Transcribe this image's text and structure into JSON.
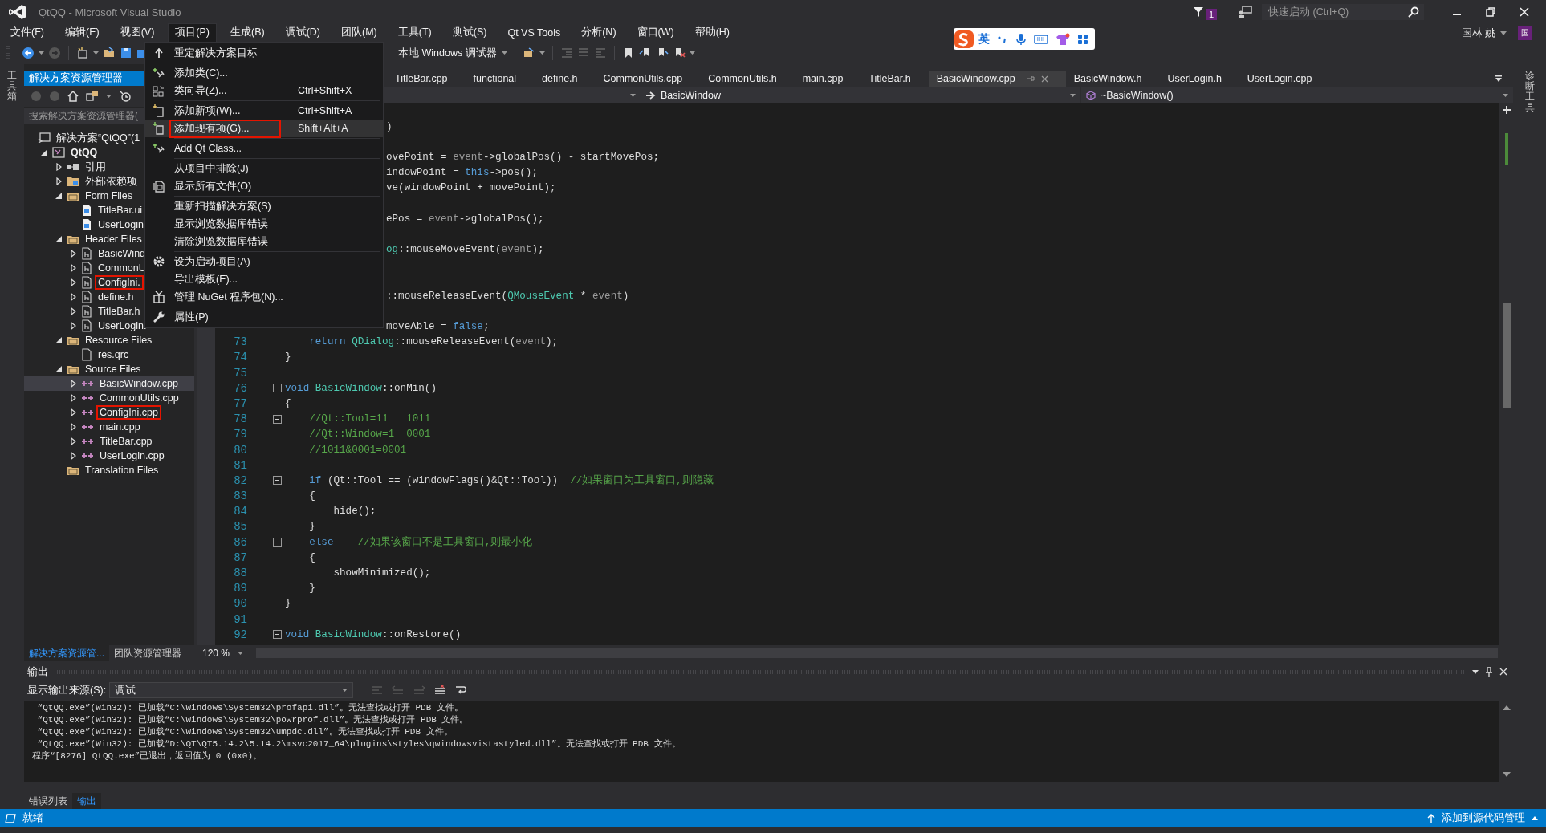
{
  "window": {
    "title": "QtQQ - Microsoft Visual Studio",
    "notification_count": "1",
    "quick_launch": {
      "placeholder": "快速启动 (Ctrl+Q)"
    }
  },
  "menu_bar": [
    {
      "label": "文件(F)",
      "selected": false
    },
    {
      "label": "编辑(E)",
      "selected": false
    },
    {
      "label": "视图(V)",
      "selected": false
    },
    {
      "label": "项目(P)",
      "selected": true
    },
    {
      "label": "生成(B)",
      "selected": false
    },
    {
      "label": "调试(D)",
      "selected": false
    },
    {
      "label": "团队(M)",
      "selected": false
    },
    {
      "label": "工具(T)",
      "selected": false
    },
    {
      "label": "测试(S)",
      "selected": false
    },
    {
      "label": "Qt VS Tools",
      "selected": false
    },
    {
      "label": "分析(N)",
      "selected": false
    },
    {
      "label": "窗口(W)",
      "selected": false
    },
    {
      "label": "帮助(H)",
      "selected": false
    }
  ],
  "account": {
    "name": "国林 姚",
    "avatar": "国"
  },
  "toolbar": {
    "debugger": "本地 Windows 调试器"
  },
  "ime_bar": {
    "mode": "英"
  },
  "side_strips": {
    "left": "工具箱",
    "right": "诊断工具"
  },
  "project_menu": [
    {
      "kind": "item",
      "label": "重定解决方案目标",
      "selected": false,
      "highlighted": false
    },
    {
      "kind": "separator"
    },
    {
      "kind": "item",
      "label": "添加类(C)...",
      "selected": false,
      "highlighted": false
    },
    {
      "kind": "item",
      "label": "类向导(Z)...",
      "shortcut": "Ctrl+Shift+X",
      "selected": false,
      "highlighted": false
    },
    {
      "kind": "separator"
    },
    {
      "kind": "item",
      "label": "添加新项(W)...",
      "shortcut": "Ctrl+Shift+A",
      "selected": false,
      "highlighted": false
    },
    {
      "kind": "item",
      "label": "添加现有项(G)...",
      "shortcut": "Shift+Alt+A",
      "selected": true,
      "highlighted": true
    },
    {
      "kind": "separator"
    },
    {
      "kind": "item",
      "label": "Add Qt Class...",
      "selected": false,
      "highlighted": false
    },
    {
      "kind": "separator"
    },
    {
      "kind": "item",
      "label": "从项目中排除(J)",
      "selected": false,
      "highlighted": false
    },
    {
      "kind": "item",
      "label": "显示所有文件(O)",
      "selected": false,
      "highlighted": false
    },
    {
      "kind": "separator"
    },
    {
      "kind": "item",
      "label": "重新扫描解决方案(S)",
      "selected": false,
      "highlighted": false
    },
    {
      "kind": "item",
      "label": "显示浏览数据库错误",
      "selected": false,
      "highlighted": false
    },
    {
      "kind": "item",
      "label": "清除浏览数据库错误",
      "selected": false,
      "highlighted": false
    },
    {
      "kind": "separator"
    },
    {
      "kind": "item",
      "label": "设为启动项目(A)",
      "selected": false,
      "highlighted": false
    },
    {
      "kind": "item",
      "label": "导出模板(E)...",
      "selected": false,
      "highlighted": false
    },
    {
      "kind": "item",
      "label": "管理 NuGet 程序包(N)...",
      "selected": false,
      "highlighted": false
    },
    {
      "kind": "separator"
    },
    {
      "kind": "item",
      "label": "属性(P)",
      "selected": false,
      "highlighted": false
    }
  ],
  "solution_explorer": {
    "title": "解决方案资源管理器",
    "search": {
      "placeholder": "搜索解决方案资源管理器("
    },
    "tree": [
      {
        "label": "解决方案“QtQQ”(1",
        "kind": "solution",
        "selected": false,
        "highlighted": false,
        "children": [
          {
            "label": "QtQQ",
            "kind": "project",
            "expanded": true,
            "selected": false,
            "highlighted": false,
            "children": [
              {
                "label": "引用",
                "kind": "references",
                "expanded": false,
                "selected": false,
                "highlighted": false
              },
              {
                "label": "外部依赖项",
                "kind": "dependencies",
                "expanded": false,
                "selected": false,
                "highlighted": false
              },
              {
                "label": "Form Files",
                "kind": "folder",
                "expanded": true,
                "selected": false,
                "highlighted": false,
                "children": [
                  {
                    "label": "TitleBar.ui",
                    "kind": "ui",
                    "selected": false,
                    "highlighted": false
                  },
                  {
                    "label": "UserLogin",
                    "kind": "ui",
                    "selected": false,
                    "highlighted": false
                  }
                ]
              },
              {
                "label": "Header Files",
                "kind": "folder",
                "expanded": true,
                "selected": false,
                "highlighted": false,
                "children": [
                  {
                    "label": "BasicWind",
                    "kind": "header",
                    "expanded": false,
                    "selected": false,
                    "highlighted": false
                  },
                  {
                    "label": "CommonU",
                    "kind": "header",
                    "expanded": false,
                    "selected": false,
                    "highlighted": false
                  },
                  {
                    "label": "ConfigIni.",
                    "kind": "header",
                    "expanded": false,
                    "selected": false,
                    "highlighted": true
                  },
                  {
                    "label": "define.h",
                    "kind": "header",
                    "expanded": false,
                    "selected": false,
                    "highlighted": false
                  },
                  {
                    "label": "TitleBar.h",
                    "kind": "header",
                    "expanded": false,
                    "selected": false,
                    "highlighted": false
                  },
                  {
                    "label": "UserLogin.",
                    "kind": "header",
                    "expanded": false,
                    "selected": false,
                    "highlighted": false
                  }
                ]
              },
              {
                "label": "Resource Files",
                "kind": "folder",
                "expanded": true,
                "selected": false,
                "highlighted": false,
                "children": [
                  {
                    "label": "res.qrc",
                    "kind": "resource",
                    "selected": false,
                    "highlighted": false
                  }
                ]
              },
              {
                "label": "Source Files",
                "kind": "folder",
                "expanded": true,
                "selected": false,
                "highlighted": false,
                "children": [
                  {
                    "label": "BasicWindow.cpp",
                    "kind": "source",
                    "expanded": false,
                    "selected": true,
                    "highlighted": false
                  },
                  {
                    "label": "CommonUtils.cpp",
                    "kind": "source",
                    "expanded": false,
                    "selected": false,
                    "highlighted": false
                  },
                  {
                    "label": "ConfigIni.cpp",
                    "kind": "source",
                    "expanded": false,
                    "selected": false,
                    "highlighted": true
                  },
                  {
                    "label": "main.cpp",
                    "kind": "source",
                    "expanded": false,
                    "selected": false,
                    "highlighted": false
                  },
                  {
                    "label": "TitleBar.cpp",
                    "kind": "source",
                    "expanded": false,
                    "selected": false,
                    "highlighted": false
                  },
                  {
                    "label": "UserLogin.cpp",
                    "kind": "source",
                    "expanded": false,
                    "selected": false,
                    "highlighted": false
                  }
                ]
              },
              {
                "label": "Translation Files",
                "kind": "folder",
                "selected": false,
                "highlighted": false
              }
            ]
          }
        ]
      }
    ],
    "tabs": [
      {
        "label": "解决方案资源管...",
        "selected": true
      },
      {
        "label": "团队资源管理器",
        "selected": false
      }
    ]
  },
  "editor": {
    "tabs": [
      {
        "label": "TitleBar.cpp",
        "selected": false
      },
      {
        "label": "functional",
        "selected": false
      },
      {
        "label": "define.h",
        "selected": false
      },
      {
        "label": "CommonUtils.cpp",
        "selected": false
      },
      {
        "label": "CommonUtils.h",
        "selected": false
      },
      {
        "label": "main.cpp",
        "selected": false
      },
      {
        "label": "TitleBar.h",
        "selected": false
      },
      {
        "label": "BasicWindow.cpp",
        "selected": true
      },
      {
        "label": "BasicWindow.h",
        "selected": false
      },
      {
        "label": "UserLogin.h",
        "selected": false
      },
      {
        "label": "UserLogin.cpp",
        "selected": false
      }
    ],
    "nav": {
      "scope": "BasicWindow",
      "member": "~BasicWindow()"
    },
    "zoom": "120 %",
    "lines": [
      {
        "kind": "covered",
        "tokens": [
          {
            "kind": "plain",
            "text": ")"
          }
        ]
      },
      {
        "kind": "covered"
      },
      {
        "kind": "covered",
        "tokens": [
          {
            "kind": "plain",
            "text": "ovePoint = "
          },
          {
            "kind": "param",
            "text": "event"
          },
          {
            "kind": "plain",
            "text": "->globalPos() - startMovePos;"
          }
        ]
      },
      {
        "kind": "covered",
        "tokens": [
          {
            "kind": "plain",
            "text": "indowPoint = "
          },
          {
            "kind": "keyword",
            "text": "this"
          },
          {
            "kind": "plain",
            "text": "->pos();"
          }
        ]
      },
      {
        "kind": "covered",
        "tokens": [
          {
            "kind": "plain",
            "text": "ve(windowPoint + movePoint);"
          }
        ]
      },
      {
        "kind": "covered"
      },
      {
        "kind": "covered",
        "tokens": [
          {
            "kind": "plain",
            "text": "ePos = "
          },
          {
            "kind": "param",
            "text": "event"
          },
          {
            "kind": "plain",
            "text": "->globalPos();"
          }
        ]
      },
      {
        "kind": "covered"
      },
      {
        "kind": "covered",
        "tokens": [
          {
            "kind": "type",
            "text": "og"
          },
          {
            "kind": "plain",
            "text": "::mouseMoveEvent("
          },
          {
            "kind": "param",
            "text": "event"
          },
          {
            "kind": "plain",
            "text": ");"
          }
        ]
      },
      {
        "kind": "covered"
      },
      {
        "kind": "covered"
      },
      {
        "kind": "covered",
        "tokens": [
          {
            "kind": "plain",
            "text": "::mouseReleaseEvent("
          },
          {
            "kind": "type",
            "text": "QMouseEvent"
          },
          {
            "kind": "plain",
            "text": " * "
          },
          {
            "kind": "param",
            "text": "event"
          },
          {
            "kind": "plain",
            "text": ")"
          }
        ]
      },
      {
        "kind": "covered"
      },
      {
        "kind": "covered",
        "tokens": [
          {
            "kind": "plain",
            "text": "moveAble = "
          },
          {
            "kind": "keyword",
            "text": "false"
          },
          {
            "kind": "plain",
            "text": ";"
          }
        ]
      },
      {
        "kind": "numbered",
        "number": "73",
        "tokens": [
          {
            "kind": "keyword",
            "text": "    return"
          },
          {
            "kind": "type",
            "text": " QDialog"
          },
          {
            "kind": "plain",
            "text": "::mouseReleaseEvent("
          },
          {
            "kind": "param",
            "text": "event"
          },
          {
            "kind": "plain",
            "text": ");"
          }
        ]
      },
      {
        "kind": "numbered",
        "number": "74",
        "tokens": [
          {
            "kind": "plain",
            "text": "}"
          }
        ]
      },
      {
        "kind": "numbered",
        "number": "75"
      },
      {
        "kind": "numbered",
        "number": "76",
        "fold": true,
        "tokens": [
          {
            "kind": "keyword",
            "text": "void"
          },
          {
            "kind": "type",
            "text": " BasicWindow"
          },
          {
            "kind": "plain",
            "text": "::onMin()"
          }
        ]
      },
      {
        "kind": "numbered",
        "number": "77",
        "tokens": [
          {
            "kind": "plain",
            "text": "{"
          }
        ]
      },
      {
        "kind": "numbered",
        "number": "78",
        "fold": true,
        "tokens": [
          {
            "kind": "comment",
            "text": "    //Qt::Tool=11   1011"
          }
        ]
      },
      {
        "kind": "numbered",
        "number": "79",
        "tokens": [
          {
            "kind": "comment",
            "text": "    //Qt::Window=1  0001"
          }
        ]
      },
      {
        "kind": "numbered",
        "number": "80",
        "tokens": [
          {
            "kind": "comment",
            "text": "    //1011&0001=0001"
          }
        ]
      },
      {
        "kind": "numbered",
        "number": "81"
      },
      {
        "kind": "numbered",
        "number": "82",
        "fold": true,
        "tokens": [
          {
            "kind": "keyword",
            "text": "    if"
          },
          {
            "kind": "plain",
            "text": " (Qt::Tool == (windowFlags()&Qt::Tool))  "
          },
          {
            "kind": "comment",
            "text": "//如果窗口为工具窗口,则隐藏"
          }
        ]
      },
      {
        "kind": "numbered",
        "number": "83",
        "tokens": [
          {
            "kind": "plain",
            "text": "    {"
          }
        ]
      },
      {
        "kind": "numbered",
        "number": "84",
        "tokens": [
          {
            "kind": "plain",
            "text": "        hide();"
          }
        ]
      },
      {
        "kind": "numbered",
        "number": "85",
        "tokens": [
          {
            "kind": "plain",
            "text": "    }"
          }
        ]
      },
      {
        "kind": "numbered",
        "number": "86",
        "fold": true,
        "tokens": [
          {
            "kind": "keyword",
            "text": "    else"
          },
          {
            "kind": "comment",
            "text": "    //如果该窗口不是工具窗口,则最小化"
          }
        ]
      },
      {
        "kind": "numbered",
        "number": "87",
        "tokens": [
          {
            "kind": "plain",
            "text": "    {"
          }
        ]
      },
      {
        "kind": "numbered",
        "number": "88",
        "tokens": [
          {
            "kind": "plain",
            "text": "        showMinimized();"
          }
        ]
      },
      {
        "kind": "numbered",
        "number": "89",
        "tokens": [
          {
            "kind": "plain",
            "text": "    }"
          }
        ]
      },
      {
        "kind": "numbered",
        "number": "90",
        "tokens": [
          {
            "kind": "plain",
            "text": "}"
          }
        ]
      },
      {
        "kind": "numbered",
        "number": "91"
      },
      {
        "kind": "numbered",
        "number": "92",
        "fold": true,
        "tokens": [
          {
            "kind": "keyword",
            "text": "void"
          },
          {
            "kind": "type",
            "text": " BasicWindow"
          },
          {
            "kind": "plain",
            "text": "::onRestore()"
          }
        ]
      }
    ]
  },
  "output": {
    "title": "输出",
    "source_label": "显示输出来源(S):",
    "source": "调试",
    "lines": [
      " “QtQQ.exe”(Win32): 已加载“C:\\Windows\\System32\\profapi.dll”。无法查找或打开 PDB 文件。",
      " “QtQQ.exe”(Win32): 已加载“C:\\Windows\\System32\\powrprof.dll”。无法查找或打开 PDB 文件。",
      " “QtQQ.exe”(Win32): 已加载“C:\\Windows\\System32\\umpdc.dll”。无法查找或打开 PDB 文件。",
      " “QtQQ.exe”(Win32): 已加载“D:\\QT\\QT5.14.2\\5.14.2\\msvc2017_64\\plugins\\styles\\qwindowsvistastyled.dll”。无法查找或打开 PDB 文件。",
      "程序“[8276] QtQQ.exe”已退出，返回值为 0 (0x0)。"
    ],
    "tabs": [
      {
        "label": "错误列表",
        "selected": false
      },
      {
        "label": "输出",
        "selected": true
      }
    ]
  },
  "status_bar": {
    "text": "就绪",
    "source_control": "添加到源代码管理"
  }
}
